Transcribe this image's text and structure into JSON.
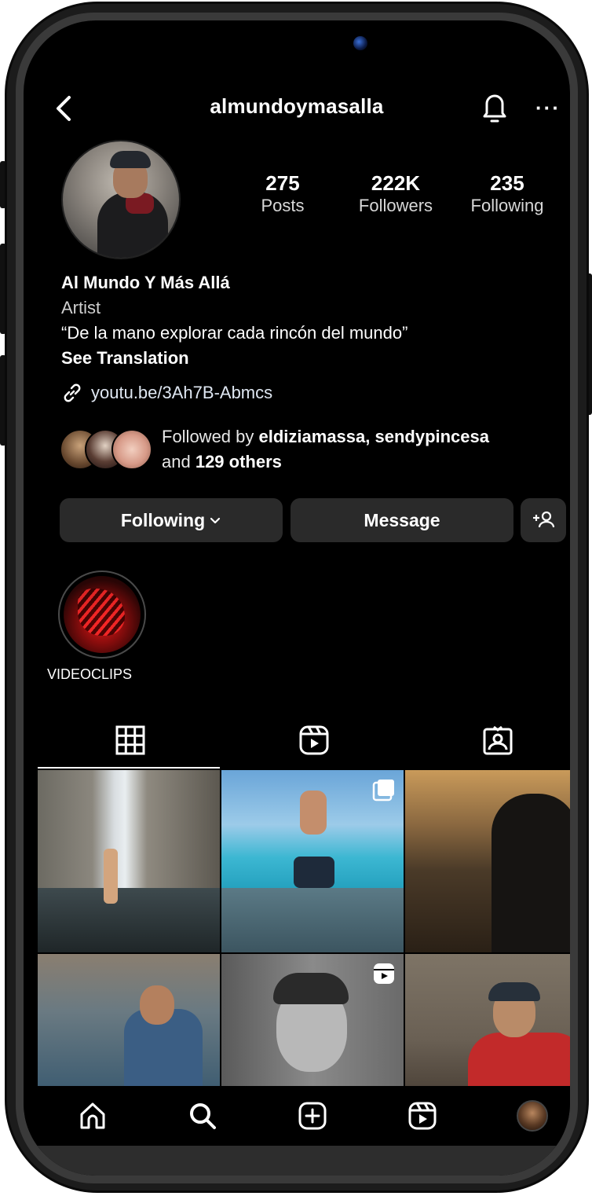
{
  "header": {
    "username": "almundoymasalla"
  },
  "stats": [
    {
      "value": "275",
      "label": "Posts"
    },
    {
      "value": "222K",
      "label": "Followers"
    },
    {
      "value": "235",
      "label": "Following"
    }
  ],
  "bio": {
    "name": "Al Mundo Y Más Allá",
    "category": "Artist",
    "quote": "“De la mano explorar cada rincón del mundo”",
    "translation": "See Translation",
    "link": "youtu.be/3Ah7B-Abmcs"
  },
  "followed_by": {
    "prefix": "Followed by ",
    "users": "eldiziamassa, sendypincesa",
    "and": "and ",
    "others": "129 others"
  },
  "actions": {
    "following_label": "Following",
    "message_label": "Message"
  },
  "highlights": [
    {
      "label": "VIDEOCLIPS"
    }
  ],
  "tabs": [
    "grid-icon",
    "reels-icon",
    "tagged-icon"
  ],
  "nav": [
    "home-icon",
    "search-icon",
    "create-icon",
    "reels-icon",
    "profile-avatar"
  ],
  "colors": {
    "background": "#000000",
    "button": "#2a2a2a",
    "highlight": "#c01414"
  }
}
